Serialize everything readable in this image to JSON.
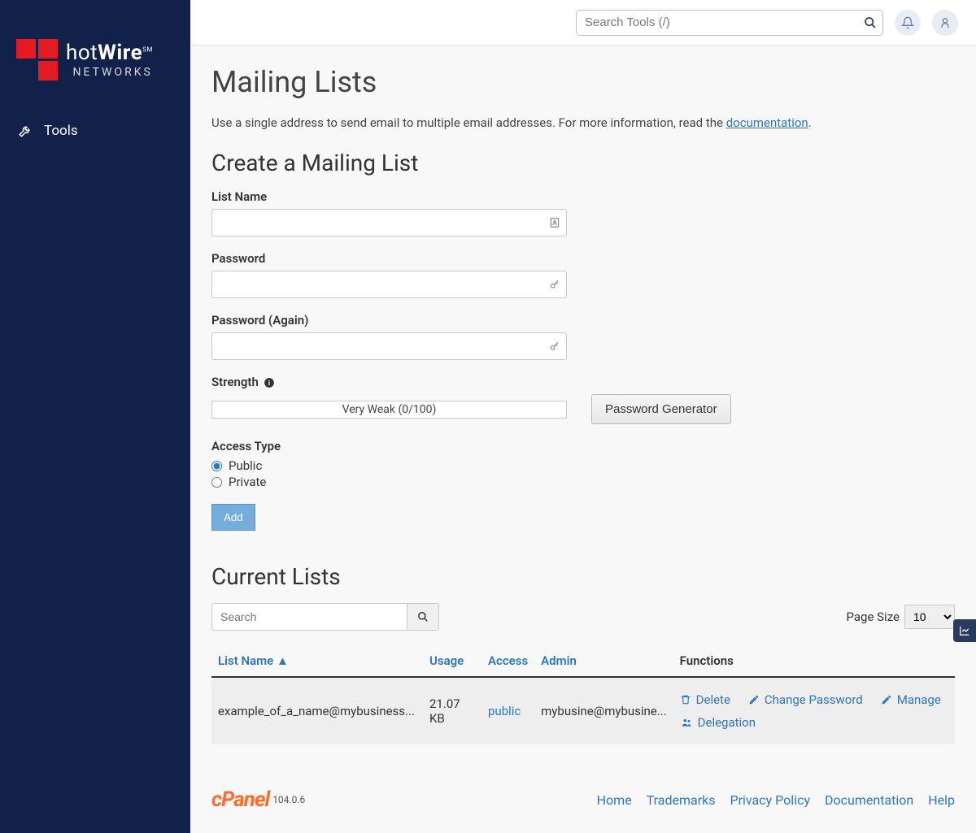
{
  "sidebar": {
    "items": [
      {
        "label": "Tools"
      }
    ]
  },
  "topbar": {
    "search_placeholder": "Search Tools (/)"
  },
  "page": {
    "title": "Mailing Lists",
    "description_pre": "Use a single address to send email to multiple email addresses. For more information, read the ",
    "doc_link": "documentation",
    "description_post": "."
  },
  "create": {
    "heading": "Create a Mailing List",
    "list_name_label": "List Name",
    "password_label": "Password",
    "password_again_label": "Password (Again)",
    "strength_label": "Strength",
    "strength_value": "Very Weak (0/100)",
    "password_generator": "Password Generator",
    "access_type_label": "Access Type",
    "public_label": "Public",
    "private_label": "Private",
    "add_label": "Add"
  },
  "lists": {
    "heading": "Current Lists",
    "search_placeholder": "Search",
    "page_size_label": "Page Size",
    "page_size_value": "10",
    "columns": {
      "list_name": "List Name ▲",
      "usage": "Usage",
      "access": "Access",
      "admin": "Admin",
      "functions": "Functions"
    },
    "rows": [
      {
        "list_name": "example_of_a_name@mybusiness...",
        "usage": "21.07 KB",
        "access": "public",
        "admin": "mybusine@mybusine..."
      }
    ],
    "functions": {
      "delete": "Delete",
      "change_password": "Change Password",
      "manage": "Manage",
      "delegation": "Delegation"
    }
  },
  "footer": {
    "brand": "cPanel",
    "version": "104.0.6",
    "links": {
      "home": "Home",
      "trademarks": "Trademarks",
      "privacy": "Privacy Policy",
      "documentation": "Documentation",
      "help": "Help"
    }
  }
}
